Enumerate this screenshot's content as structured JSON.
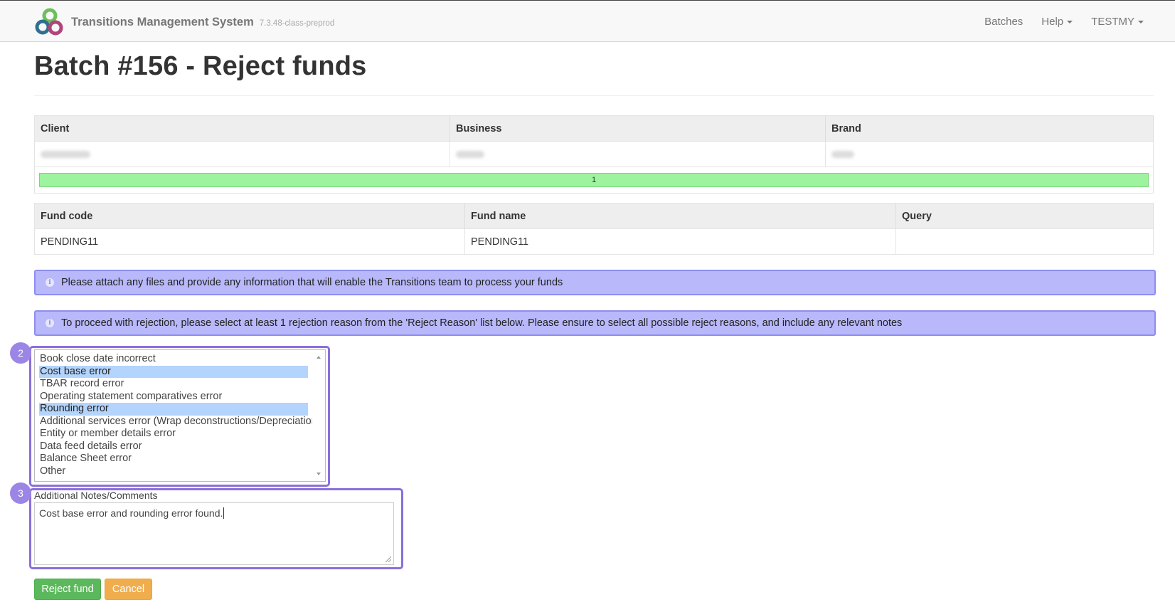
{
  "navbar": {
    "title": "Transitions Management System",
    "version": "7.3.48-class-preprod",
    "links": [
      {
        "label": "Batches",
        "dropdown": false
      },
      {
        "label": "Help",
        "dropdown": true
      },
      {
        "label": "TESTMY",
        "dropdown": true
      }
    ]
  },
  "page": {
    "title": "Batch #156 - Reject funds"
  },
  "client_table": {
    "headers": [
      "Client",
      "Business",
      "Brand"
    ],
    "progress_label": "1",
    "progress_fraction": 1.0
  },
  "fund_table": {
    "headers": [
      "Fund code",
      "Fund name",
      "Query"
    ],
    "row": [
      "PENDING11",
      "PENDING11",
      ""
    ]
  },
  "alerts": [
    "Please attach any files and provide any information that will enable the Transitions team to process your funds",
    "To proceed with rejection, please select at least 1 rejection reason from the 'Reject Reason' list below. Please ensure to select all possible reject reasons, and include any relevant notes"
  ],
  "reasons": [
    {
      "label": "Book close date incorrect",
      "selected": false
    },
    {
      "label": "Cost base error",
      "selected": true
    },
    {
      "label": "TBAR record error",
      "selected": false
    },
    {
      "label": "Operating statement comparatives error",
      "selected": false
    },
    {
      "label": "Rounding error",
      "selected": true
    },
    {
      "label": "Additional services error (Wrap deconstructions/Depreciation)",
      "selected": false
    },
    {
      "label": "Entity or member details error",
      "selected": false
    },
    {
      "label": "Data feed details error",
      "selected": false
    },
    {
      "label": "Balance Sheet error",
      "selected": false
    },
    {
      "label": "Other",
      "selected": false
    }
  ],
  "annotations": {
    "badge_reasons": "2",
    "badge_notes": "3"
  },
  "notes": {
    "label": "Additional Notes/Comments",
    "value": "Cost base error and rounding error found."
  },
  "buttons": {
    "reject": "Reject fund",
    "cancel": "Cancel"
  },
  "colors": {
    "alert_bg": "#b8b8fb",
    "annotation": "#8a6fdc",
    "progress": "#9ef49e",
    "btn_reject": "#5cb85c",
    "btn_cancel": "#f0ad4e",
    "selected_option": "#b3d4fc"
  }
}
